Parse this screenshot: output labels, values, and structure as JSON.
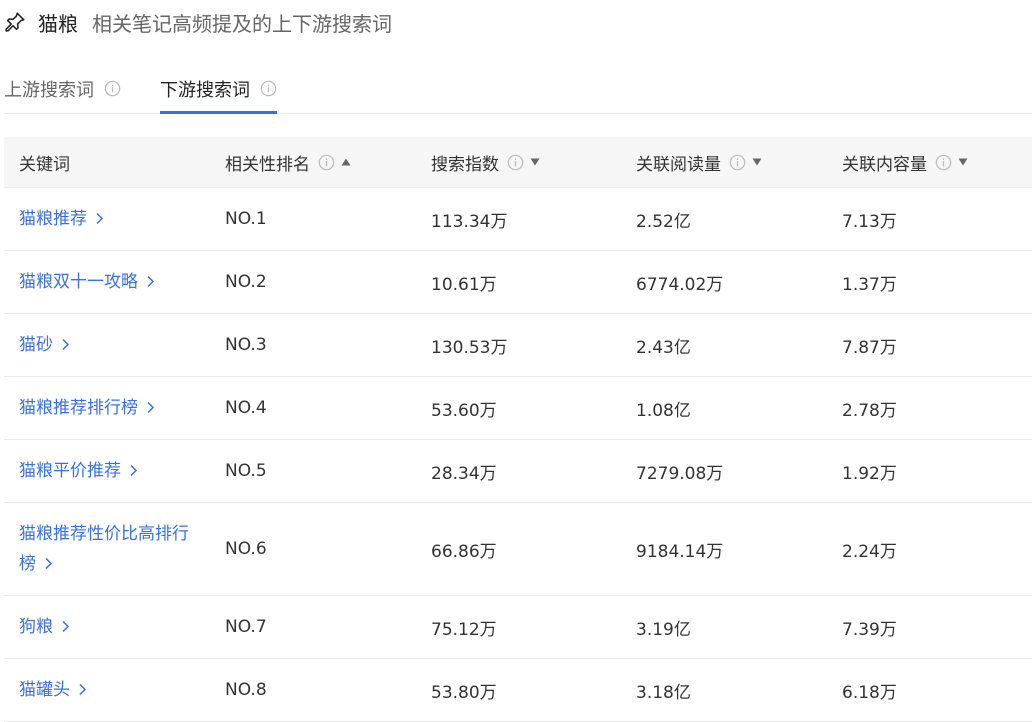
{
  "header": {
    "keyword": "猫粮",
    "subtitle": "相关笔记高频提及的上下游搜索词"
  },
  "tabs": [
    {
      "label": "上游搜索词",
      "active": false
    },
    {
      "label": "下游搜索词",
      "active": true
    }
  ],
  "table": {
    "columns": [
      "关键词",
      "相关性排名",
      "搜索指数",
      "关联阅读量",
      "关联内容量"
    ],
    "rows": [
      {
        "keyword": "猫粮推荐",
        "rank": "NO.1",
        "search_index": "113.34万",
        "read_volume": "2.52亿",
        "content_volume": "7.13万"
      },
      {
        "keyword": "猫粮双十一攻略",
        "rank": "NO.2",
        "search_index": "10.61万",
        "read_volume": "6774.02万",
        "content_volume": "1.37万"
      },
      {
        "keyword": "猫砂",
        "rank": "NO.3",
        "search_index": "130.53万",
        "read_volume": "2.43亿",
        "content_volume": "7.87万"
      },
      {
        "keyword": "猫粮推荐排行榜",
        "rank": "NO.4",
        "search_index": "53.60万",
        "read_volume": "1.08亿",
        "content_volume": "2.78万"
      },
      {
        "keyword": "猫粮平价推荐",
        "rank": "NO.5",
        "search_index": "28.34万",
        "read_volume": "7279.08万",
        "content_volume": "1.92万"
      },
      {
        "keyword": "猫粮推荐性价比高排行榜",
        "rank": "NO.6",
        "search_index": "66.86万",
        "read_volume": "9184.14万",
        "content_volume": "2.24万"
      },
      {
        "keyword": "狗粮",
        "rank": "NO.7",
        "search_index": "75.12万",
        "read_volume": "3.19亿",
        "content_volume": "7.39万"
      },
      {
        "keyword": "猫罐头",
        "rank": "NO.8",
        "search_index": "53.80万",
        "read_volume": "3.18亿",
        "content_volume": "6.18万"
      }
    ]
  },
  "icons": {
    "header": "pin-icon",
    "tab_info": "info-icon",
    "sort_asc": "sort-up-icon",
    "sort_desc": "sort-down-icon",
    "row_link": "chevron-right-icon"
  },
  "colors": {
    "accent": "#3b6fe6",
    "header_bg": "#f6f6f7",
    "divider": "#ececec",
    "muted_icon": "#bbbbbb"
  }
}
